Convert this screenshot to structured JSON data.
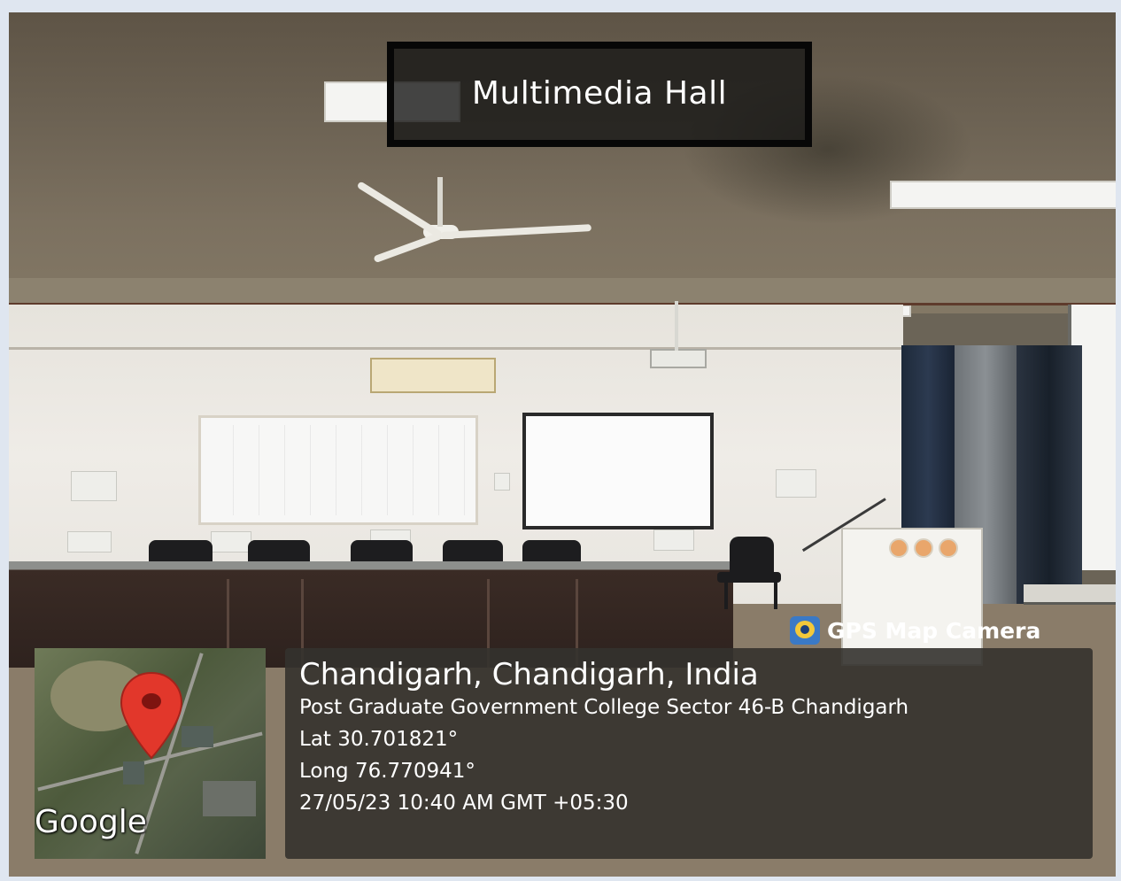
{
  "title": "Multimedia Hall",
  "gps_badge": {
    "label": "GPS Map Camera",
    "icon": "camera-app-icon"
  },
  "map": {
    "brand": "Google",
    "pin_icon": "map-pin-icon",
    "pin_color": "#e2372b"
  },
  "location": {
    "city_line": "Chandigarh, Chandigarh, India",
    "address": "Post Graduate Government College Sector 46-B Chandigarh",
    "lat": "Lat 30.701821°",
    "long": "Long 76.770941°",
    "timestamp": "27/05/23 10:40 AM GMT +05:30"
  }
}
